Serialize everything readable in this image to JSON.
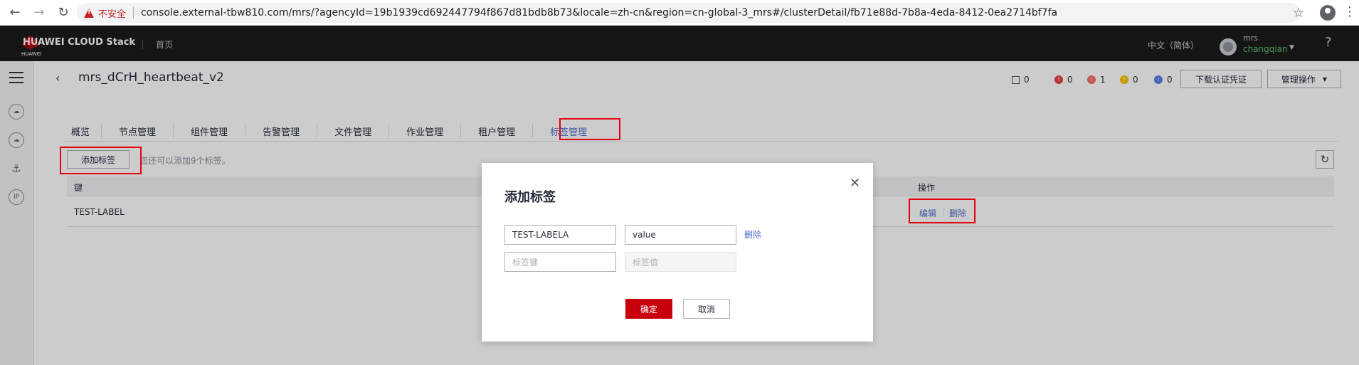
{
  "browser": {
    "security_label": "不安全",
    "url": "console.external-tbw810.com/mrs/?agencyId=19b1939cd692447794f867d81bdb8b73&locale=zh-cn&region=cn-global-3_mrs#/clusterDetail/fb71e88d-7b8a-4eda-8412-0ea2714bf7fa"
  },
  "header": {
    "logo_text": "HUAWEI CLOUD Stack",
    "logo_sub": "HUAWEI",
    "home_link": "首页",
    "language": "中文（简体）",
    "user_account": "mrs",
    "user_name": "changqian",
    "help": "?"
  },
  "cluster": {
    "title": "mrs_dCrH_heartbeat_v2",
    "stats": [
      {
        "icon": "host-icon",
        "value": "0"
      },
      {
        "icon": "critical-alarm-icon",
        "value": "0",
        "color": "#e54545"
      },
      {
        "icon": "major-alarm-icon",
        "value": "1",
        "color": "#f66f6a"
      },
      {
        "icon": "minor-alarm-icon",
        "value": "0",
        "color": "#fac20a"
      },
      {
        "icon": "info-alarm-icon",
        "value": "0",
        "color": "#5e7ce0"
      }
    ],
    "download_button": "下载认证凭证",
    "manage_button": "管理操作"
  },
  "tabs": [
    "概览",
    "节点管理",
    "组件管理",
    "告警管理",
    "文件管理",
    "作业管理",
    "租户管理",
    "标签管理"
  ],
  "tags": {
    "add_button": "添加标签",
    "hint": "您还可以添加9个标签。",
    "columns": {
      "key": "键",
      "operation": "操作"
    },
    "rows": [
      {
        "key": "TEST-LABEL",
        "edit": "编辑",
        "delete": "删除"
      }
    ]
  },
  "modal": {
    "title": "添加标签",
    "row1": {
      "key": "TEST-LABELA",
      "value": "value",
      "delete": "删除"
    },
    "row2": {
      "key_placeholder": "标签键",
      "value_placeholder": "标签值"
    },
    "ok": "确定",
    "cancel": "取消"
  }
}
